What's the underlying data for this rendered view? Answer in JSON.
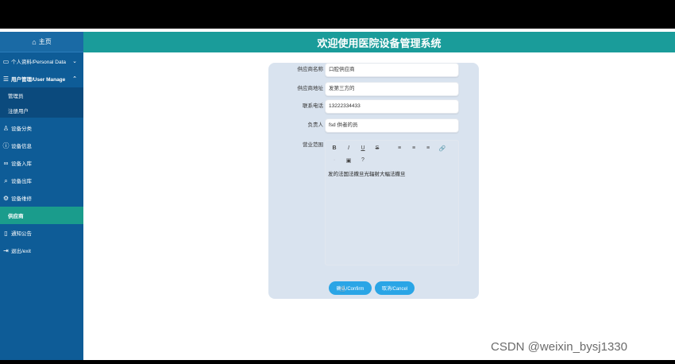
{
  "header": {
    "title": "欢迎使用医院设备管理系统"
  },
  "sidebar": {
    "home": "主页",
    "items": [
      {
        "label": "个人资料/Personal Data",
        "icon": "person-card-icon",
        "chevron": "⌄"
      },
      {
        "label": "用户管理/User Manage",
        "icon": "users-icon",
        "chevron": "⌃"
      },
      {
        "label": "设备分类",
        "icon": "person-icon"
      },
      {
        "label": "设备信息",
        "icon": "info-icon"
      },
      {
        "label": "设备入库",
        "icon": "link-icon"
      },
      {
        "label": "设备出库",
        "icon": "search-icon"
      },
      {
        "label": "设备维修",
        "icon": "gear-icon"
      },
      {
        "label": "供应商",
        "icon": ""
      },
      {
        "label": "通知公告",
        "icon": "mobile-icon"
      },
      {
        "label": "退出/exit",
        "icon": "exit-icon"
      }
    ],
    "sub_items": [
      "管理员",
      "注册用户"
    ]
  },
  "form": {
    "fields": [
      {
        "label": "供应商名称",
        "value": "口腔供应商"
      },
      {
        "label": "供应商地址",
        "value": "发第三方的"
      },
      {
        "label": "联系电话",
        "value": "13222334433"
      },
      {
        "label": "负责人",
        "value": "fsd 供者的员"
      }
    ],
    "scope_label": "营业范围",
    "editor_toolbar": [
      "B",
      "I",
      "U",
      "S",
      "≡",
      "≡",
      "≡",
      "🔗",
      "·",
      "▣",
      "?"
    ],
    "editor_content": "发的法国法撒旦光辐射大幅法撒旦"
  },
  "buttons": {
    "confirm": "确认/Confirm",
    "cancel": "取消/Cancel"
  },
  "watermark": "CSDN @weixin_bysj1330"
}
